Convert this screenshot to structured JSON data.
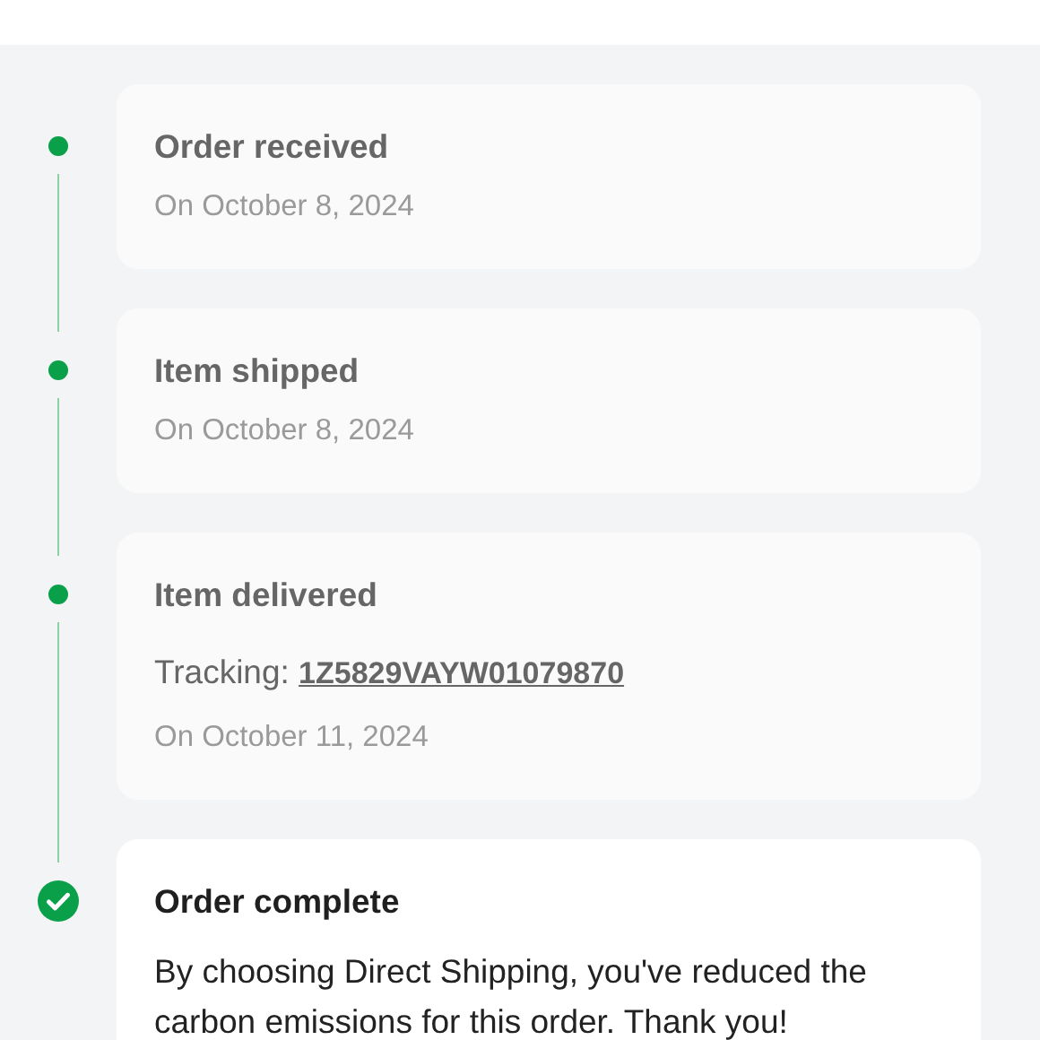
{
  "steps": [
    {
      "kind": "dot",
      "title": "Order received",
      "date": "On October 8, 2024",
      "current": false
    },
    {
      "kind": "dot",
      "title": "Item shipped",
      "date": "On October 8, 2024",
      "current": false
    },
    {
      "kind": "dot",
      "title": "Item delivered",
      "tracking": {
        "label": "Tracking:",
        "number": "1Z5829VAYW01079870"
      },
      "date": "On October 11, 2024",
      "current": false
    },
    {
      "kind": "check",
      "title": "Order complete",
      "message": "By choosing Direct Shipping, you've reduced the carbon emissions for this order. Thank you!",
      "current": true
    }
  ]
}
